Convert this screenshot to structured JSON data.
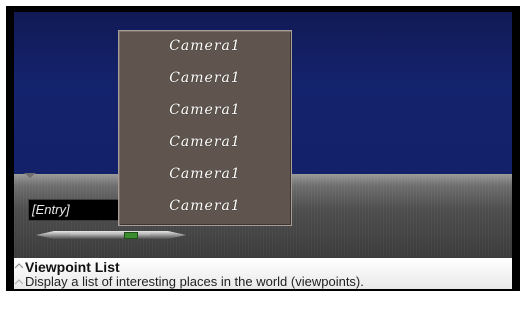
{
  "window": {
    "frame_color": "#000000",
    "viewport_color": "#14236d"
  },
  "entry_field": {
    "value": "[Entry]"
  },
  "viewpoint_menu": {
    "items": [
      "Camera1",
      "Camera1",
      "Camera1",
      "Camera1",
      "Camera1",
      "Camera1"
    ],
    "background": "#5f554e"
  },
  "slider": {
    "thumb_color": "#3a8c2e"
  },
  "info_panel": {
    "title": "Viewpoint List",
    "description": "Display a list of interesting places in the world (viewpoints)."
  },
  "icons": [
    "collapse-arrow-icon",
    "caret-up-icon"
  ]
}
